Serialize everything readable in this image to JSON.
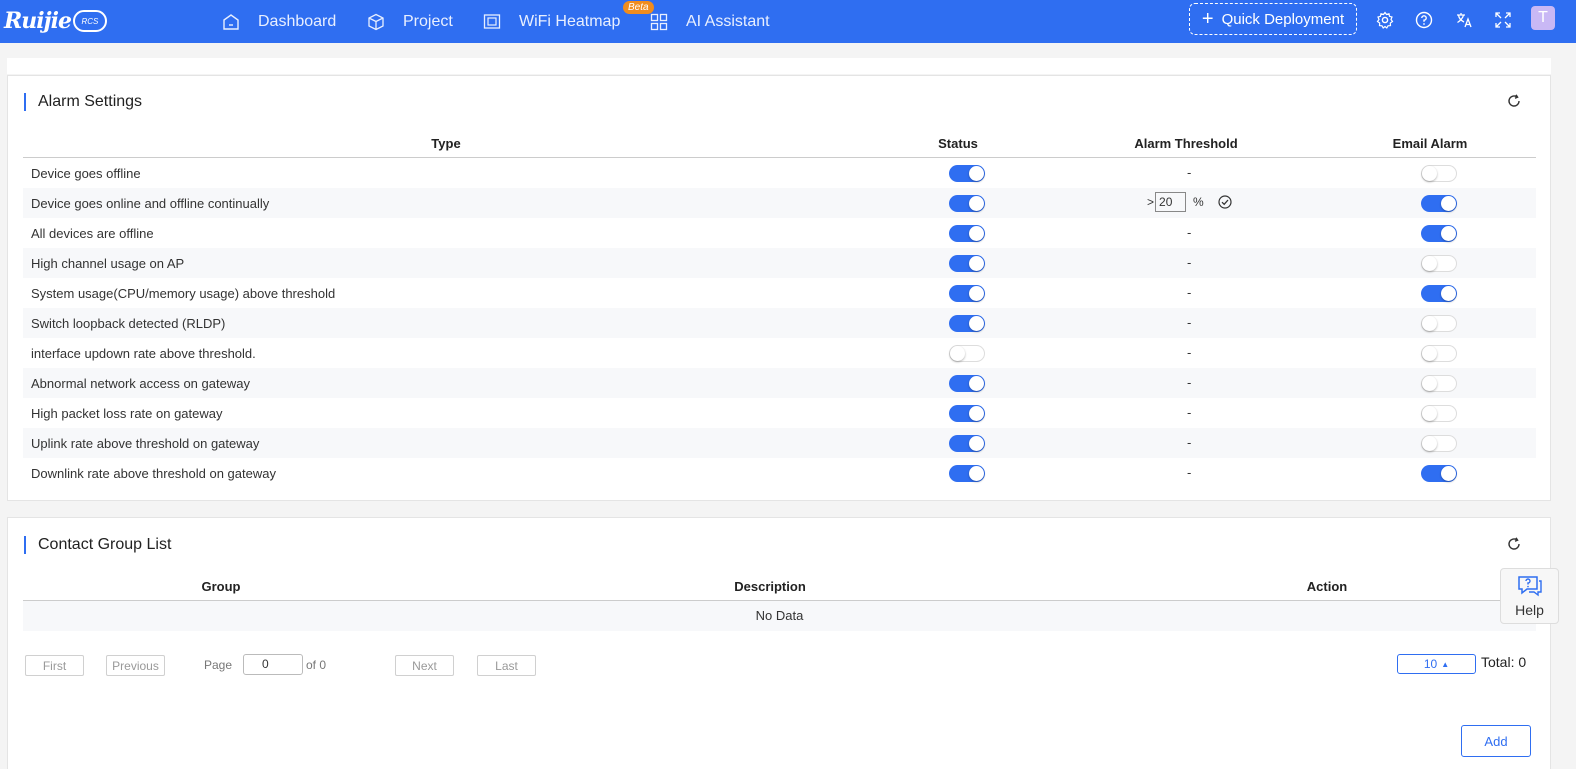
{
  "nav": {
    "brand": "Ruijie",
    "brand_sub": "RCS",
    "items": [
      {
        "label": "Dashboard",
        "icon": "home-icon"
      },
      {
        "label": "Project",
        "icon": "cube-icon"
      },
      {
        "label": "WiFi Heatmap",
        "icon": "heatmap-icon"
      },
      {
        "label": "AI Assistant",
        "icon": "grid-icon"
      }
    ],
    "beta_badge": "Beta",
    "quick_deployment": "Quick Deployment",
    "avatar_letter": "T"
  },
  "alarm": {
    "title": "Alarm Settings",
    "columns": {
      "type": "Type",
      "status": "Status",
      "threshold": "Alarm Threshold",
      "email": "Email Alarm"
    },
    "rows": [
      {
        "type": "Device goes offline",
        "status": true,
        "threshold": "-",
        "email": false
      },
      {
        "type": "Device goes online and offline continually",
        "status": true,
        "threshold": "input",
        "email": true
      },
      {
        "type": "All devices are offline",
        "status": true,
        "threshold": "-",
        "email": true
      },
      {
        "type": "High channel usage on AP",
        "status": true,
        "threshold": "-",
        "email": false
      },
      {
        "type": "System usage(CPU/memory usage) above threshold",
        "status": true,
        "threshold": "-",
        "email": true
      },
      {
        "type": "Switch loopback detected (RLDP)",
        "status": true,
        "threshold": "-",
        "email": false
      },
      {
        "type": "interface updown rate above threshold.",
        "status": false,
        "threshold": "-",
        "email": false
      },
      {
        "type": "Abnormal network access on gateway",
        "status": true,
        "threshold": "-",
        "email": false
      },
      {
        "type": "High packet loss rate on gateway",
        "status": true,
        "threshold": "-",
        "email": false
      },
      {
        "type": "Uplink rate above threshold on gateway",
        "status": true,
        "threshold": "-",
        "email": false
      },
      {
        "type": "Downlink rate above threshold on gateway",
        "status": true,
        "threshold": "-",
        "email": true
      }
    ],
    "threshold_input": {
      "prefix": ">",
      "value": "20",
      "unit": "%"
    }
  },
  "contacts": {
    "title": "Contact Group List",
    "columns": {
      "group": "Group",
      "description": "Description",
      "action": "Action"
    },
    "empty": "No Data",
    "pager": {
      "first": "First",
      "previous": "Previous",
      "page_label": "Page",
      "page_value": "0",
      "of_label": "of 0",
      "next": "Next",
      "last": "Last",
      "page_size": "10",
      "total": "Total: 0"
    },
    "add": "Add"
  },
  "help": {
    "label": "Help"
  },
  "colors": {
    "primary": "#2f6ef1",
    "beta": "#f08c1e"
  }
}
